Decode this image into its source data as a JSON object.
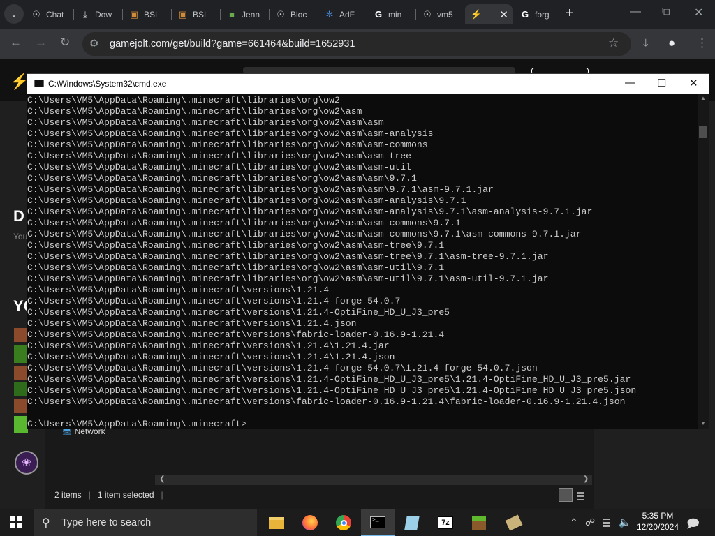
{
  "browser": {
    "tabs": [
      {
        "label": "Chat",
        "icon": "globe"
      },
      {
        "label": "Dow",
        "icon": "download"
      },
      {
        "label": "BSL",
        "icon": "cube"
      },
      {
        "label": "BSL",
        "icon": "cube"
      },
      {
        "label": "Jenn",
        "icon": "grass-block"
      },
      {
        "label": "Bloc",
        "icon": "globe"
      },
      {
        "label": "AdF",
        "icon": "swirl"
      },
      {
        "label": "min",
        "icon": "google"
      },
      {
        "label": "vm5",
        "icon": "globe"
      },
      {
        "label": "",
        "icon": "gamejolt-bolt"
      },
      {
        "label": "forg",
        "icon": "google"
      }
    ],
    "url": "gamejolt.com/get/build?game=661464&build=1652931"
  },
  "background_page": {
    "heading_d": "D",
    "sub_text": "You",
    "heading_yo": "YO",
    "network_label": "Network",
    "status_items": "2 items",
    "status_selected": "1 item selected"
  },
  "cmd": {
    "title": "C:\\Windows\\System32\\cmd.exe",
    "lines": [
      "C:\\Users\\VM5\\AppData\\Roaming\\.minecraft\\libraries\\org\\ow2",
      "C:\\Users\\VM5\\AppData\\Roaming\\.minecraft\\libraries\\org\\ow2\\asm",
      "C:\\Users\\VM5\\AppData\\Roaming\\.minecraft\\libraries\\org\\ow2\\asm\\asm",
      "C:\\Users\\VM5\\AppData\\Roaming\\.minecraft\\libraries\\org\\ow2\\asm\\asm-analysis",
      "C:\\Users\\VM5\\AppData\\Roaming\\.minecraft\\libraries\\org\\ow2\\asm\\asm-commons",
      "C:\\Users\\VM5\\AppData\\Roaming\\.minecraft\\libraries\\org\\ow2\\asm\\asm-tree",
      "C:\\Users\\VM5\\AppData\\Roaming\\.minecraft\\libraries\\org\\ow2\\asm\\asm-util",
      "C:\\Users\\VM5\\AppData\\Roaming\\.minecraft\\libraries\\org\\ow2\\asm\\asm\\9.7.1",
      "C:\\Users\\VM5\\AppData\\Roaming\\.minecraft\\libraries\\org\\ow2\\asm\\asm\\9.7.1\\asm-9.7.1.jar",
      "C:\\Users\\VM5\\AppData\\Roaming\\.minecraft\\libraries\\org\\ow2\\asm\\asm-analysis\\9.7.1",
      "C:\\Users\\VM5\\AppData\\Roaming\\.minecraft\\libraries\\org\\ow2\\asm\\asm-analysis\\9.7.1\\asm-analysis-9.7.1.jar",
      "C:\\Users\\VM5\\AppData\\Roaming\\.minecraft\\libraries\\org\\ow2\\asm\\asm-commons\\9.7.1",
      "C:\\Users\\VM5\\AppData\\Roaming\\.minecraft\\libraries\\org\\ow2\\asm\\asm-commons\\9.7.1\\asm-commons-9.7.1.jar",
      "C:\\Users\\VM5\\AppData\\Roaming\\.minecraft\\libraries\\org\\ow2\\asm\\asm-tree\\9.7.1",
      "C:\\Users\\VM5\\AppData\\Roaming\\.minecraft\\libraries\\org\\ow2\\asm\\asm-tree\\9.7.1\\asm-tree-9.7.1.jar",
      "C:\\Users\\VM5\\AppData\\Roaming\\.minecraft\\libraries\\org\\ow2\\asm\\asm-util\\9.7.1",
      "C:\\Users\\VM5\\AppData\\Roaming\\.minecraft\\libraries\\org\\ow2\\asm\\asm-util\\9.7.1\\asm-util-9.7.1.jar",
      "C:\\Users\\VM5\\AppData\\Roaming\\.minecraft\\versions\\1.21.4",
      "C:\\Users\\VM5\\AppData\\Roaming\\.minecraft\\versions\\1.21.4-forge-54.0.7",
      "C:\\Users\\VM5\\AppData\\Roaming\\.minecraft\\versions\\1.21.4-OptiFine_HD_U_J3_pre5",
      "C:\\Users\\VM5\\AppData\\Roaming\\.minecraft\\versions\\1.21.4.json",
      "C:\\Users\\VM5\\AppData\\Roaming\\.minecraft\\versions\\fabric-loader-0.16.9-1.21.4",
      "C:\\Users\\VM5\\AppData\\Roaming\\.minecraft\\versions\\1.21.4\\1.21.4.jar",
      "C:\\Users\\VM5\\AppData\\Roaming\\.minecraft\\versions\\1.21.4\\1.21.4.json",
      "C:\\Users\\VM5\\AppData\\Roaming\\.minecraft\\versions\\1.21.4-forge-54.0.7\\1.21.4-forge-54.0.7.json",
      "C:\\Users\\VM5\\AppData\\Roaming\\.minecraft\\versions\\1.21.4-OptiFine_HD_U_J3_pre5\\1.21.4-OptiFine_HD_U_J3_pre5.jar",
      "C:\\Users\\VM5\\AppData\\Roaming\\.minecraft\\versions\\1.21.4-OptiFine_HD_U_J3_pre5\\1.21.4-OptiFine_HD_U_J3_pre5.json",
      "C:\\Users\\VM5\\AppData\\Roaming\\.minecraft\\versions\\fabric-loader-0.16.9-1.21.4\\fabric-loader-0.16.9-1.21.4.json",
      "",
      "C:\\Users\\VM5\\AppData\\Roaming\\.minecraft>"
    ]
  },
  "taskbar": {
    "search_placeholder": "Type here to search",
    "time": "5:35 PM",
    "date": "12/20/2024"
  }
}
